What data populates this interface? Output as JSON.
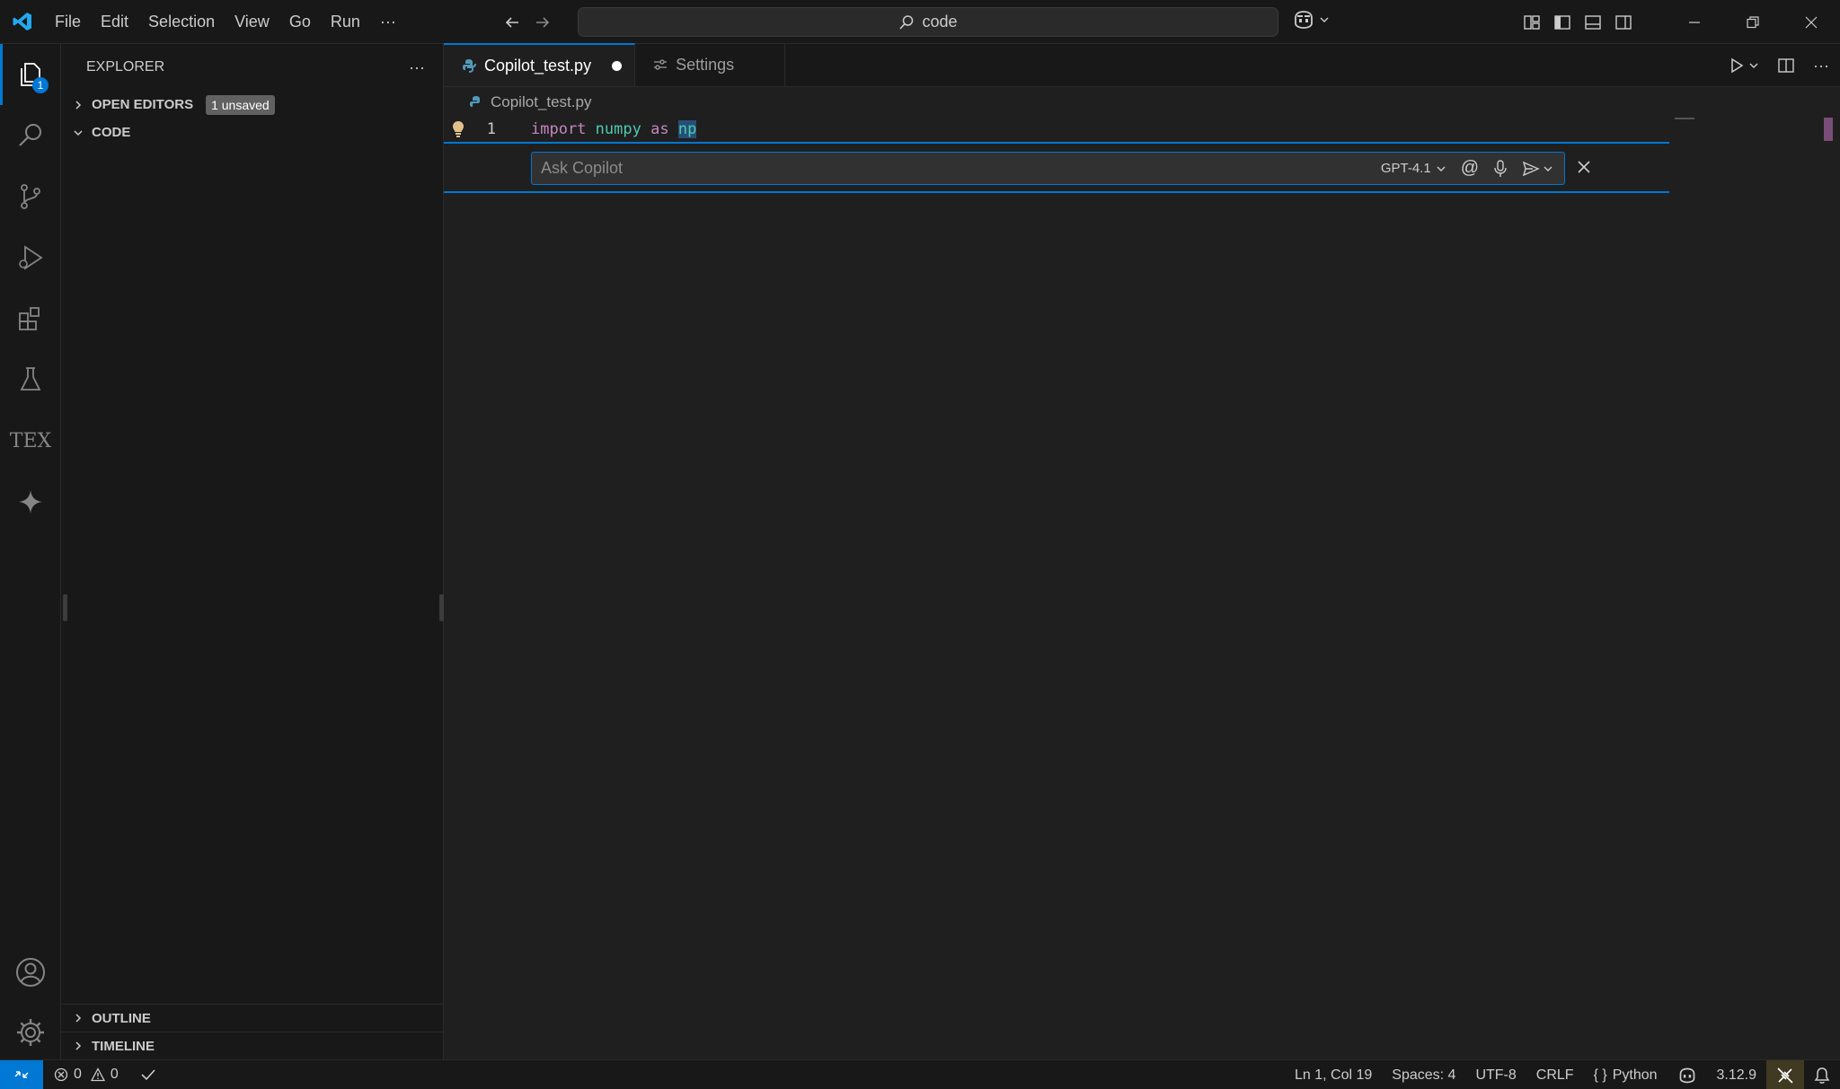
{
  "titlebar": {
    "menu": [
      "File",
      "Edit",
      "Selection",
      "View",
      "Go",
      "Run"
    ],
    "more": "···",
    "command_center": "code"
  },
  "activity": {
    "explorer_badge": "1",
    "icons": [
      "files-icon",
      "search-icon",
      "source-control-icon",
      "run-debug-icon",
      "extensions-icon",
      "testing-icon",
      "tex-icon",
      "copilot-sparkle-icon",
      "account-icon",
      "gear-icon"
    ],
    "tex_label": "TEX"
  },
  "sidebar": {
    "title": "EXPLORER",
    "more": "···",
    "open_editors": "OPEN EDITORS",
    "unsaved_badge": "1 unsaved",
    "folder": "CODE",
    "outline": "OUTLINE",
    "timeline": "TIMELINE"
  },
  "editor": {
    "tabs": [
      {
        "label": "Copilot_test.py",
        "dirty": true
      },
      {
        "label": "Settings"
      }
    ],
    "breadcrumb": "Copilot_test.py",
    "line_number": "1",
    "code": {
      "kw1": "import",
      "mod": "numpy",
      "kw2": "as",
      "alias": "np"
    },
    "inline_chat": {
      "placeholder": "Ask Copilot",
      "model": "GPT-4.1",
      "mention": "@"
    }
  },
  "statusbar": {
    "errors": "0",
    "warnings": "0",
    "position": "Ln 1, Col 19",
    "spaces": "Spaces: 4",
    "encoding": "UTF-8",
    "eol": "CRLF",
    "language": "Python",
    "python_version": "3.12.9"
  },
  "colors": {
    "accent": "#0078d4",
    "background": "#1f1f1f",
    "chrome": "#181818"
  }
}
